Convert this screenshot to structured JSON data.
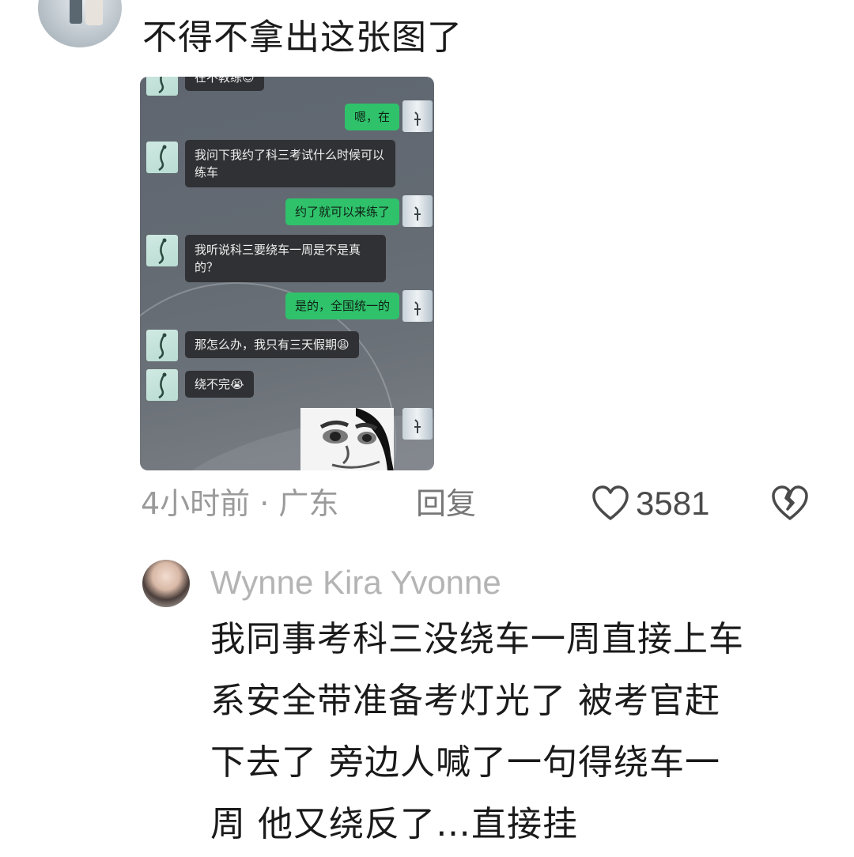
{
  "comment": {
    "text": "不得不拿出这张图了",
    "time_location": "4小时前 · 广东",
    "reply_label": "回复",
    "like_count": "3581"
  },
  "chat_screenshot": {
    "messages": [
      {
        "side": "left",
        "text": "在不教练😊"
      },
      {
        "side": "right",
        "text": "嗯，在"
      },
      {
        "side": "left",
        "text": "我问下我约了科三考试什么时候可以练车"
      },
      {
        "side": "right",
        "text": "约了就可以来练了"
      },
      {
        "side": "left",
        "text": "我听说科三要绕车一周是不是真的？"
      },
      {
        "side": "right",
        "text": "是的，全国统一的"
      },
      {
        "side": "left",
        "text": "那怎么办，我只有三天假期😩"
      },
      {
        "side": "left",
        "text": "绕不完😭"
      }
    ],
    "colors": {
      "left_bubble": "#2f3134",
      "right_bubble": "#2fc26b"
    }
  },
  "reply": {
    "username": "Wynne Kira Yvonne",
    "lines": [
      "我同事考科三没绕车一周直接上车",
      "系安全带准备考灯光了 被考官赶",
      "下去了 旁边人喊了一句得绕车一",
      "周 他又绕反了…直接挂"
    ]
  },
  "icons": {
    "like": "heart-outline-icon",
    "dislike": "broken-heart-icon"
  }
}
